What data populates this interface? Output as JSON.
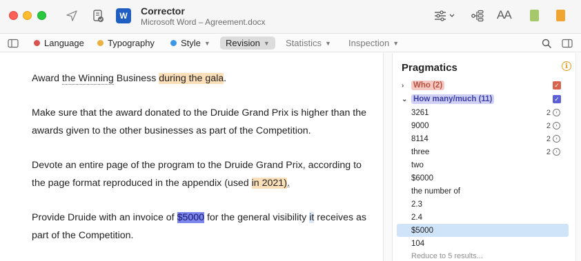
{
  "window": {
    "app_title": "Corrector",
    "document": "Microsoft Word – Agreement.docx",
    "word_icon_letter": "W",
    "font_size_label": "AA"
  },
  "toolbar": {
    "tabs": [
      {
        "label": "Language",
        "color": "#d9534f"
      },
      {
        "label": "Typography",
        "color": "#ebb040"
      },
      {
        "label": "Style",
        "color": "#3d98e8"
      },
      {
        "label": "Revision"
      },
      {
        "label": "Statistics"
      },
      {
        "label": "Inspection"
      }
    ]
  },
  "document": {
    "p1": {
      "a": "Award ",
      "b": "the Winning",
      "c": " Business ",
      "d": "during the gala",
      "e": "."
    },
    "p2": {
      "text": "Make sure that the award donated to the Druide Grand Prix is higher than the awards given to the other businesses as part of the Competition."
    },
    "p3": {
      "a": "Devote an entire page of the program to the Druide Grand Prix, according to the page format reproduced in the appendix (used ",
      "b": "in 2021)",
      "c": "."
    },
    "p4": {
      "a": "Provide Druide with an invoice of ",
      "b": "$5000",
      "c": " for the general visibility ",
      "d": "it",
      "e": " receives as part of the Competition."
    }
  },
  "panel": {
    "title": "Pragmatics",
    "info_icon": "i",
    "groups": [
      {
        "label": "Who (2)",
        "color": "#d9634c"
      },
      {
        "label": "How many/much (11)",
        "color": "#5a5fd6"
      }
    ],
    "items": [
      {
        "label": "3261",
        "count": "2"
      },
      {
        "label": "9000",
        "count": "2"
      },
      {
        "label": "8114",
        "count": "2"
      },
      {
        "label": "three",
        "count": "2"
      },
      {
        "label": "two",
        "count": ""
      },
      {
        "label": "$6000",
        "count": ""
      },
      {
        "label": "the number of",
        "count": ""
      },
      {
        "label": "2.3",
        "count": ""
      },
      {
        "label": "2.4",
        "count": ""
      },
      {
        "label": "$5000",
        "count": "",
        "selected": true
      },
      {
        "label": "104",
        "count": ""
      }
    ],
    "more": "Reduce to 5 results..."
  }
}
